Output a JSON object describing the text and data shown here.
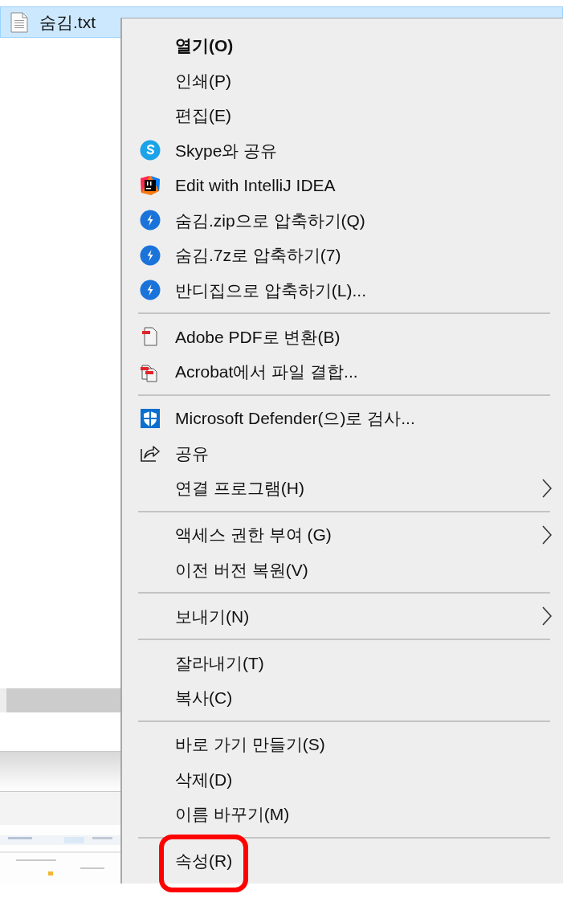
{
  "file_row": {
    "name": "숨김.txt",
    "selected": true
  },
  "menu": {
    "sections": [
      [
        {
          "label": "열기(O)",
          "default": true,
          "submenu": false,
          "highlighted": false
        },
        {
          "label": "인쇄(P)",
          "default": false,
          "submenu": false,
          "highlighted": false
        },
        {
          "label": "편집(E)",
          "default": false,
          "submenu": false,
          "highlighted": false
        },
        {
          "label": "Skype와 공유",
          "default": false,
          "submenu": false,
          "highlighted": false
        },
        {
          "label": "Edit with IntelliJ IDEA",
          "default": false,
          "submenu": false,
          "highlighted": false
        },
        {
          "label": "숨김.zip으로 압축하기(Q)",
          "default": false,
          "submenu": false,
          "highlighted": false
        },
        {
          "label": "숨김.7z로 압축하기(7)",
          "default": false,
          "submenu": false,
          "highlighted": false
        },
        {
          "label": "반디집으로 압축하기(L)...",
          "default": false,
          "submenu": false,
          "highlighted": false
        }
      ],
      [
        {
          "label": "Adobe PDF로 변환(B)",
          "default": false,
          "submenu": false,
          "highlighted": false
        },
        {
          "label": "Acrobat에서 파일 결합...",
          "default": false,
          "submenu": false,
          "highlighted": false
        }
      ],
      [
        {
          "label": "Microsoft Defender(으)로 검사...",
          "default": false,
          "submenu": false,
          "highlighted": false
        },
        {
          "label": "공유",
          "default": false,
          "submenu": false,
          "highlighted": false
        },
        {
          "label": "연결 프로그램(H)",
          "default": false,
          "submenu": true,
          "highlighted": false
        }
      ],
      [
        {
          "label": "액세스 권한 부여 (G)",
          "default": false,
          "submenu": true,
          "highlighted": false
        },
        {
          "label": "이전 버전 복원(V)",
          "default": false,
          "submenu": false,
          "highlighted": false
        }
      ],
      [
        {
          "label": "보내기(N)",
          "default": false,
          "submenu": true,
          "highlighted": false
        }
      ],
      [
        {
          "label": "잘라내기(T)",
          "default": false,
          "submenu": false,
          "highlighted": false
        },
        {
          "label": "복사(C)",
          "default": false,
          "submenu": false,
          "highlighted": false
        }
      ],
      [
        {
          "label": "바로 가기 만들기(S)",
          "default": false,
          "submenu": false,
          "highlighted": false
        },
        {
          "label": "삭제(D)",
          "default": false,
          "submenu": false,
          "highlighted": false
        },
        {
          "label": "이름 바꾸기(M)",
          "default": false,
          "submenu": false,
          "highlighted": false
        }
      ],
      [
        {
          "label": "속성(R)",
          "default": false,
          "submenu": false,
          "highlighted": true
        }
      ]
    ]
  }
}
